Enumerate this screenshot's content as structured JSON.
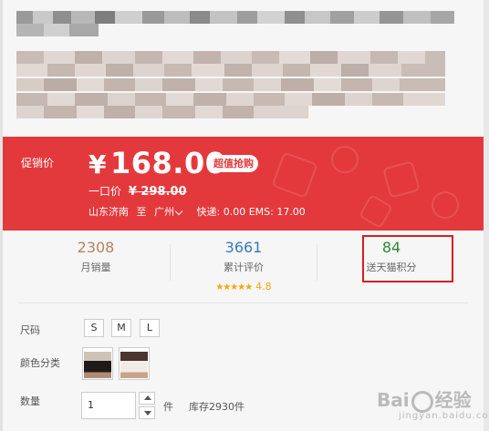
{
  "price_panel": {
    "promo_label": "促销价",
    "currency_symbol": "¥",
    "price": "168.00",
    "badge": "超值抢购",
    "original_label": "一口价",
    "original_currency": "¥",
    "original_price": "298.00",
    "shipping": {
      "origin": "山东济南",
      "to": "至",
      "destination": "广州",
      "fee_text": "快递: 0.00 EMS: 17.00"
    }
  },
  "stats": [
    {
      "value": "2308",
      "label": "月销量",
      "color": "#b5845a"
    },
    {
      "value": "3661",
      "label": "累计评价",
      "color": "#3a7ab7",
      "stars": "★★★★★",
      "rating": "4.8"
    },
    {
      "value": "84",
      "label": "送天猫积分",
      "color": "#2f8a2f"
    }
  ],
  "options": {
    "size_label": "尺码",
    "sizes": [
      "S",
      "M",
      "L"
    ],
    "color_label": "颜色分类",
    "quantity_label": "数量",
    "quantity_value": "1",
    "unit": "件",
    "stock": "库存2930件"
  },
  "colors": {
    "accent": "#e4393c",
    "highlight_box": "#d81e1e"
  },
  "watermark": {
    "brand": "Bai",
    "brand_suffix": "经验",
    "domain": "jingyan.baidu.com"
  }
}
